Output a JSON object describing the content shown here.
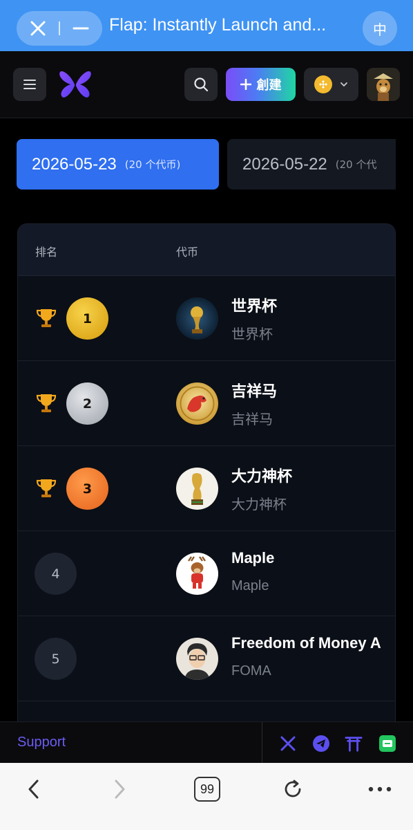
{
  "browser": {
    "title": "Flap: Instantly Launch and...",
    "lang_button": "中"
  },
  "header": {
    "create_label": "創建",
    "chain": "BNB"
  },
  "date_tabs": [
    {
      "date": "2026-05-23",
      "count": "(20 个代币)",
      "active": true
    },
    {
      "date": "2026-05-22",
      "count": "(20 个代",
      "active": false
    }
  ],
  "table": {
    "columns": [
      "排名",
      "代币"
    ],
    "rows": [
      {
        "rank": "1",
        "name": "世界杯",
        "symbol": "世界杯",
        "medal": "gold",
        "trophy": true
      },
      {
        "rank": "2",
        "name": "吉祥马",
        "symbol": "吉祥马",
        "medal": "silver",
        "trophy": true
      },
      {
        "rank": "3",
        "name": "大力神杯",
        "symbol": "大力神杯",
        "medal": "bronze",
        "trophy": true
      },
      {
        "rank": "4",
        "name": "Maple",
        "symbol": "Maple",
        "medal": "plain",
        "trophy": false
      },
      {
        "rank": "5",
        "name": "Freedom of Money A",
        "symbol": "FOMA",
        "medal": "plain",
        "trophy": false
      }
    ]
  },
  "footer": {
    "support_label": "Support",
    "social_icons": [
      "x-icon",
      "telegram-icon",
      "torii-gate-icon",
      "green-chat-icon"
    ]
  },
  "bottom_toolbar": {
    "tabs_count": "99"
  },
  "colors": {
    "accent_blue": "#2f6ff0",
    "browser_bar": "#3f93f3",
    "support_purple": "#6b5cf3",
    "gold": "#e4ad18",
    "silver": "#c3c6cc",
    "bronze": "#f07a2e"
  }
}
